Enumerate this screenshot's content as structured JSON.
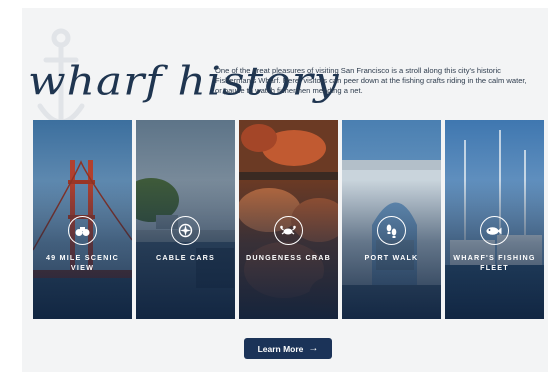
{
  "section": {
    "title": "wharf history",
    "intro": "One of the great pleasures of visiting San Francisco is a stroll along this city's historic Fisherman's Wharf. Here, visitors can peer down at the fishing crafts riding in the calm water, or pause to watch fishermen mending a net."
  },
  "tiles": [
    {
      "label": "49 Mile Scenic View",
      "icon": "binoculars-icon"
    },
    {
      "label": "Cable Cars",
      "icon": "compass-icon"
    },
    {
      "label": "Dungeness Crab",
      "icon": "crab-icon"
    },
    {
      "label": "Port Walk",
      "icon": "footprints-icon"
    },
    {
      "label": "Wharf's Fishing Fleet",
      "icon": "fish-icon"
    }
  ],
  "cta": {
    "label": "Learn More",
    "arrow": "→"
  },
  "colors": {
    "panel": "#f3f4f5",
    "title": "#1f3550",
    "button": "#1b3358"
  }
}
